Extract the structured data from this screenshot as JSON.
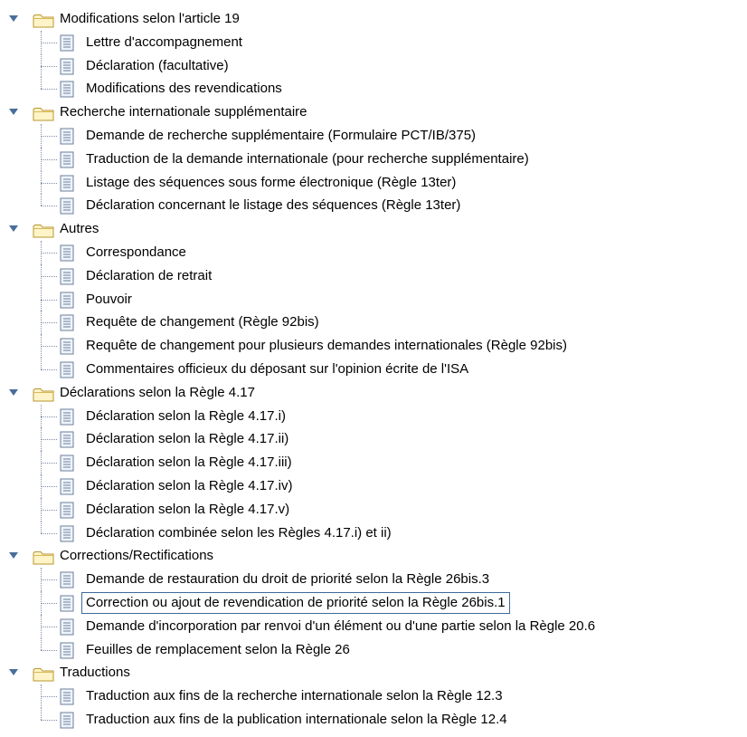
{
  "tree": [
    {
      "label": "Modifications selon l'article 19",
      "expanded": true,
      "icon": "folder-icon",
      "children": [
        "Lettre d'accompagnement",
        "Déclaration (facultative)",
        "Modifications des revendications"
      ]
    },
    {
      "label": "Recherche internationale supplémentaire",
      "expanded": true,
      "icon": "folder-icon",
      "children": [
        "Demande de recherche supplémentaire (Formulaire PCT/IB/375)",
        "Traduction de la demande internationale (pour recherche supplémentaire)",
        "Listage des séquences sous forme électronique (Règle 13ter)",
        "Déclaration concernant le listage des séquences (Règle 13ter)"
      ]
    },
    {
      "label": "Autres",
      "expanded": true,
      "icon": "folder-icon",
      "children": [
        "Correspondance",
        "Déclaration de retrait",
        "Pouvoir",
        "Requête de changement (Règle 92bis)",
        "Requête de changement pour plusieurs demandes internationales (Règle 92bis)",
        "Commentaires officieux du déposant sur l'opinion écrite de l'ISA"
      ]
    },
    {
      "label": "Déclarations selon la Règle 4.17",
      "expanded": true,
      "icon": "folder-icon",
      "children": [
        "Déclaration selon la Règle 4.17.i)",
        "Déclaration selon la Règle 4.17.ii)",
        "Déclaration selon la Règle 4.17.iii)",
        "Déclaration selon la Règle 4.17.iv)",
        "Déclaration selon la Règle 4.17.v)",
        "Déclaration combinée selon les Règles 4.17.i) et ii)"
      ]
    },
    {
      "label": "Corrections/Rectifications",
      "expanded": true,
      "icon": "folder-icon",
      "children": [
        "Demande de restauration du droit de priorité selon la Règle 26bis.3",
        "Correction ou ajout de revendication de priorité selon la Règle 26bis.1",
        "Demande d'incorporation par renvoi d'un élément ou d'une partie selon la Règle 20.6",
        "Feuilles de remplacement selon la Règle 26"
      ]
    },
    {
      "label": "Traductions",
      "expanded": true,
      "icon": "folder-icon",
      "children": [
        "Traduction aux fins de la recherche internationale selon la Règle 12.3",
        "Traduction aux fins de la publication internationale selon la Règle 12.4"
      ]
    }
  ],
  "selected": "Correction ou ajout de revendication de priorité selon la Règle 26bis.1"
}
